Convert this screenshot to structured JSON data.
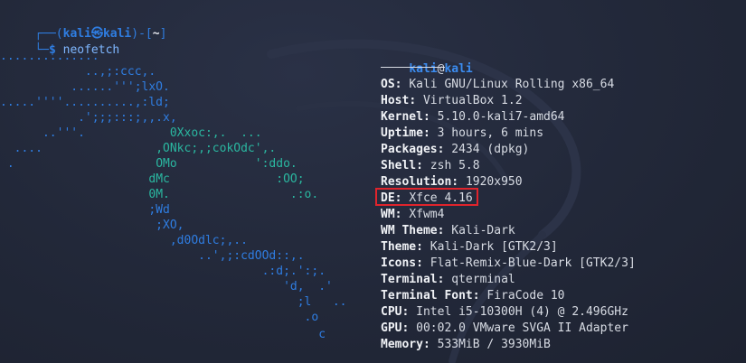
{
  "prompt": {
    "frame_top": "┌──(",
    "user": "kali",
    "at_symbol": "㉿",
    "host": "kali",
    "close": ")-[",
    "dir": "~",
    "close_dir": "]",
    "frame_bottom": "└─",
    "dollar": "$",
    "command": "neofetch"
  },
  "logo_lines": [
    "..............",
    "            ..,;:ccc,.",
    "          ......''';lxO.",
    ".....''''..........,:ld;",
    "           .';;;:::;,,.x,",
    "      ..'''.            0Xxoc:,.  ...",
    "  ....                ,ONkc;,;cokOdc',.",
    " .                    OMo           ':ddo.",
    "                     dMc               :OO;",
    "                     0M.                 .:o.",
    "                     ;Wd",
    "                      ;XO,",
    "                        ,d0Odlc;,..",
    "                            ..',;:cdOOd::,.",
    "                                     .:d;.':;.",
    "                                        'd,  .'",
    "                                          ;l   ..",
    "                                           .o",
    "                                             c"
  ],
  "userhost": {
    "user": "kali",
    "at": "@",
    "host": "kali"
  },
  "info": [
    {
      "key": "OS",
      "value": "Kali GNU/Linux Rolling x86_64"
    },
    {
      "key": "Host",
      "value": "VirtualBox 1.2"
    },
    {
      "key": "Kernel",
      "value": "5.10.0-kali7-amd64"
    },
    {
      "key": "Uptime",
      "value": "3 hours, 6 mins"
    },
    {
      "key": "Packages",
      "value": "2434 (dpkg)"
    },
    {
      "key": "Shell",
      "value": "zsh 5.8"
    },
    {
      "key": "Resolution",
      "value": "1920x950"
    },
    {
      "key": "DE",
      "value": "Xfce 4.16"
    },
    {
      "key": "WM",
      "value": "Xfwm4"
    },
    {
      "key": "WM Theme",
      "value": "Kali-Dark"
    },
    {
      "key": "Theme",
      "value": "Kali-Dark [GTK2/3]"
    },
    {
      "key": "Icons",
      "value": "Flat-Remix-Blue-Dark [GTK2/3]"
    },
    {
      "key": "Terminal",
      "value": "qterminal"
    },
    {
      "key": "Terminal Font",
      "value": "FiraCode 10"
    },
    {
      "key": "CPU",
      "value": "Intel i5-10300H (4) @ 2.496GHz"
    },
    {
      "key": "GPU",
      "value": "00:02.0 VMware SVGA II Adapter"
    },
    {
      "key": "Memory",
      "value": "533MiB / 3930MiB"
    }
  ],
  "colors": {
    "prompt_blue": "#2f7de1",
    "logo_blue": "#2f7de1",
    "logo_teal": "#2ab7a0",
    "highlight_red": "#e0242c",
    "background": "#222839"
  }
}
